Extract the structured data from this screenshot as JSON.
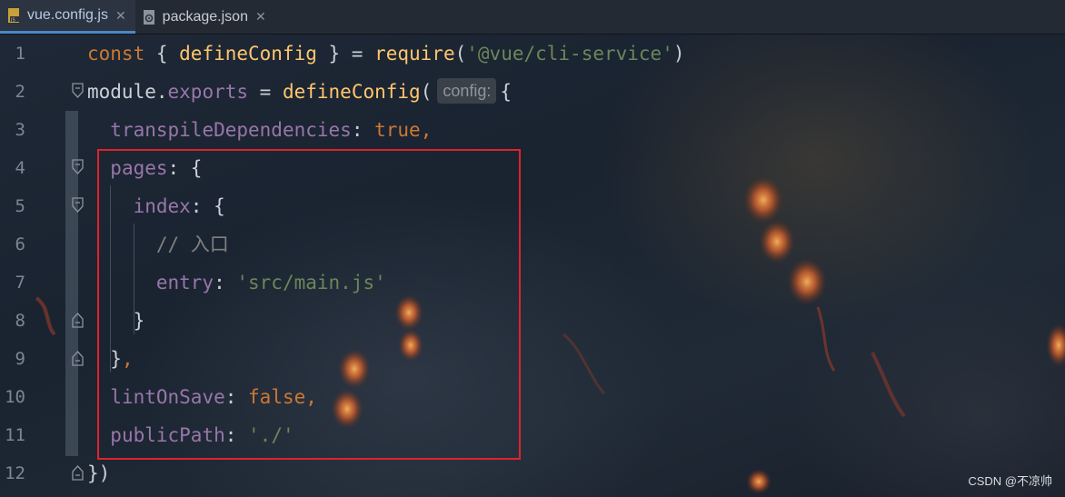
{
  "tabs": [
    {
      "label": "vue.config.js",
      "icon": "javascript-file-icon",
      "active": true
    },
    {
      "label": "package.json",
      "icon": "json-file-icon",
      "active": false
    }
  ],
  "editor": {
    "inlay_hint": "config:",
    "lines": [
      {
        "number": "1",
        "tokens": [
          {
            "t": "const",
            "c": "kw"
          },
          {
            "t": " { ",
            "c": "pl"
          },
          {
            "t": "defineConfig",
            "c": "fn"
          },
          {
            "t": " } = ",
            "c": "pl"
          },
          {
            "t": "require",
            "c": "fn"
          },
          {
            "t": "(",
            "c": "pl"
          },
          {
            "t": "'@vue/cli-service'",
            "c": "str"
          },
          {
            "t": ")",
            "c": "pl"
          }
        ]
      },
      {
        "number": "2",
        "tokens": [
          {
            "t": "module",
            "c": "pl"
          },
          {
            "t": ".",
            "c": "pl"
          },
          {
            "t": "exports",
            "c": "prop"
          },
          {
            "t": " = ",
            "c": "pl"
          },
          {
            "t": "defineConfig",
            "c": "fn"
          },
          {
            "t": "(",
            "c": "pl"
          },
          {
            "t": "config:",
            "c": "hint"
          },
          {
            "t": "{",
            "c": "pl"
          }
        ]
      },
      {
        "number": "3",
        "tokens": [
          {
            "t": "  ",
            "c": "pl"
          },
          {
            "t": "transpileDependencies",
            "c": "prop"
          },
          {
            "t": ": ",
            "c": "pl"
          },
          {
            "t": "true",
            "c": "kw"
          },
          {
            "t": ",",
            "c": "kw"
          }
        ]
      },
      {
        "number": "4",
        "tokens": [
          {
            "t": "  ",
            "c": "pl"
          },
          {
            "t": "pages",
            "c": "prop"
          },
          {
            "t": ": {",
            "c": "pl"
          }
        ]
      },
      {
        "number": "5",
        "tokens": [
          {
            "t": "    ",
            "c": "pl"
          },
          {
            "t": "index",
            "c": "prop"
          },
          {
            "t": ": {",
            "c": "pl"
          }
        ]
      },
      {
        "number": "6",
        "tokens": [
          {
            "t": "      ",
            "c": "pl"
          },
          {
            "t": "// 入口",
            "c": "cm"
          }
        ]
      },
      {
        "number": "7",
        "tokens": [
          {
            "t": "      ",
            "c": "pl"
          },
          {
            "t": "entry",
            "c": "prop"
          },
          {
            "t": ": ",
            "c": "pl"
          },
          {
            "t": "'src/main.js'",
            "c": "str"
          }
        ]
      },
      {
        "number": "8",
        "tokens": [
          {
            "t": "    }",
            "c": "pl"
          }
        ]
      },
      {
        "number": "9",
        "tokens": [
          {
            "t": "  }",
            "c": "pl"
          },
          {
            "t": ",",
            "c": "kw"
          }
        ]
      },
      {
        "number": "10",
        "tokens": [
          {
            "t": "  ",
            "c": "pl"
          },
          {
            "t": "lintOnSave",
            "c": "prop"
          },
          {
            "t": ": ",
            "c": "pl"
          },
          {
            "t": "false",
            "c": "kw"
          },
          {
            "t": ",",
            "c": "kw"
          }
        ]
      },
      {
        "number": "11",
        "tokens": [
          {
            "t": "  ",
            "c": "pl"
          },
          {
            "t": "publicPath",
            "c": "prop"
          },
          {
            "t": ": ",
            "c": "pl"
          },
          {
            "t": "'./'",
            "c": "str"
          }
        ]
      },
      {
        "number": "12",
        "tokens": [
          {
            "t": "})",
            "c": "pl"
          }
        ]
      }
    ]
  },
  "watermark": "CSDN @不凉帅",
  "colors": {
    "keyword": "#cc7832",
    "function": "#ffc66d",
    "property": "#9876aa",
    "string": "#6a8759",
    "comment": "#808080",
    "highlight_box": "#e0222b"
  }
}
